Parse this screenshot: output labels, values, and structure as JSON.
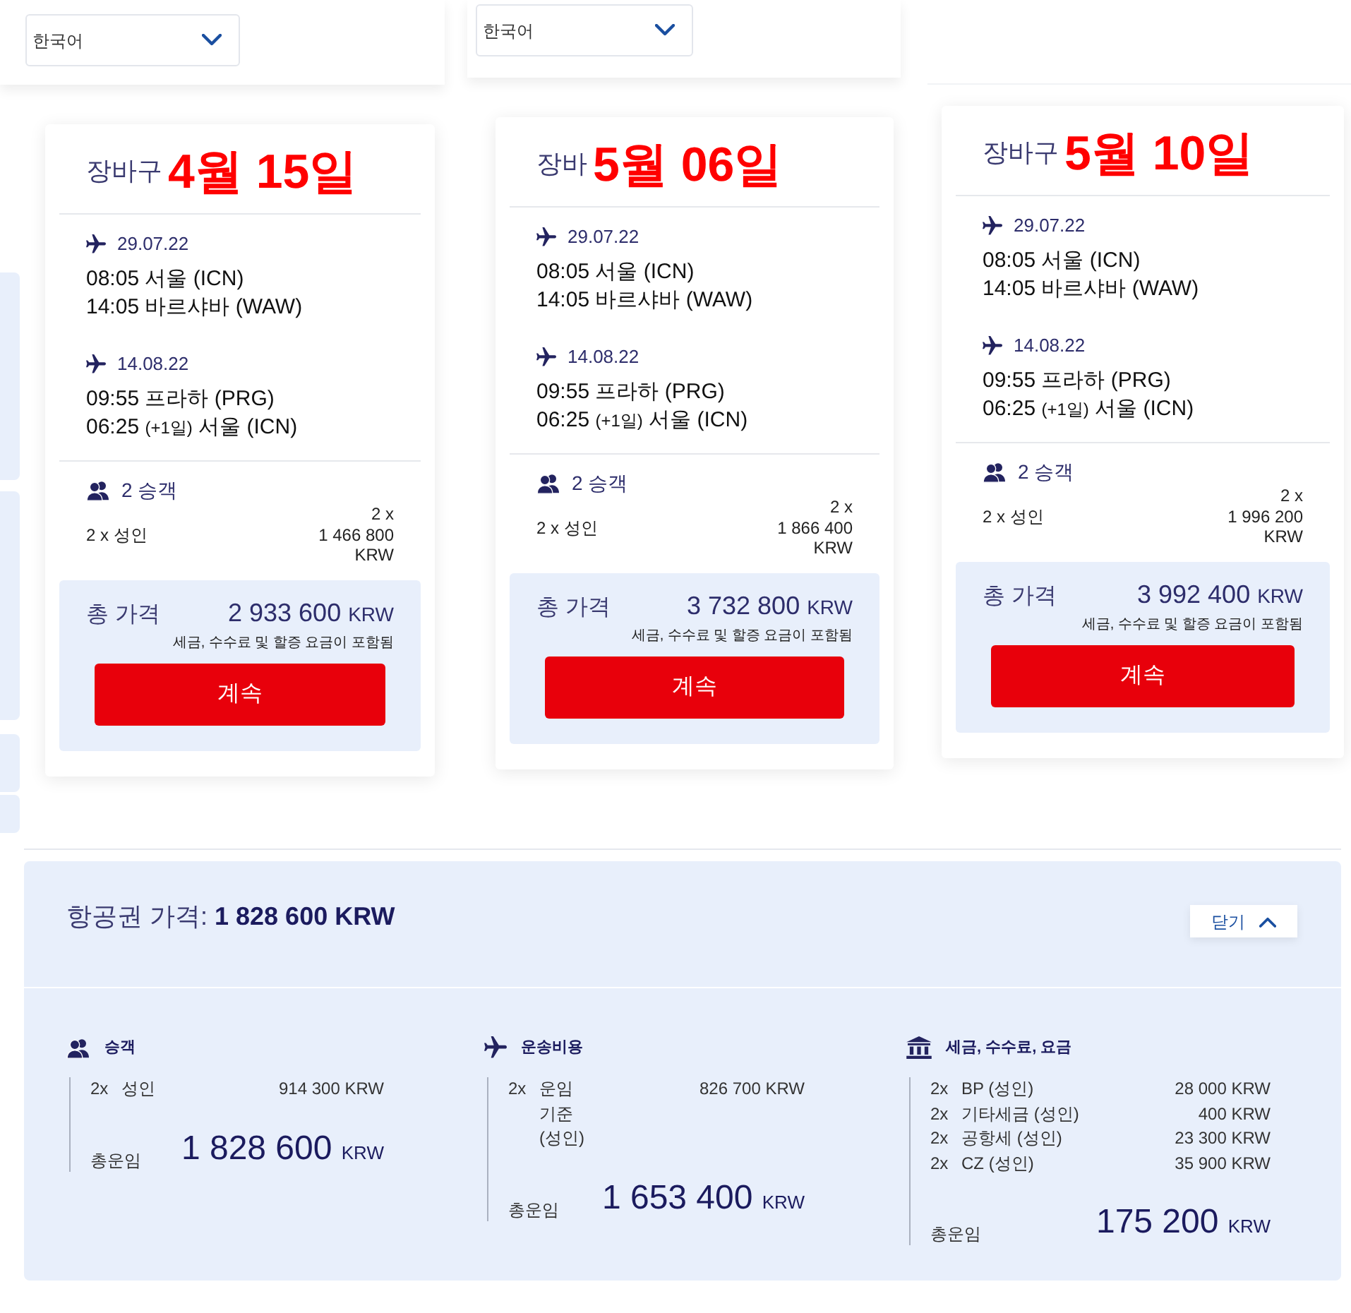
{
  "carts": [
    {
      "language": "한국어",
      "title": "장바구",
      "annotation": "4월 15일",
      "flights": [
        {
          "date": "29.07.22",
          "lines": [
            {
              "time": "08:05",
              "place": "서울 (ICN)"
            },
            {
              "time": "14:05",
              "place": "바르샤바 (WAW)"
            }
          ]
        },
        {
          "date": "14.08.22",
          "lines": [
            {
              "time": "09:55",
              "place": "프라하 (PRG)"
            },
            {
              "time": "06:25",
              "day_offset": "(+1일)",
              "place": "서울 (ICN)"
            }
          ]
        }
      ],
      "passengers": {
        "label": "2 승객",
        "rows": [
          {
            "label": "2 x 성인",
            "price_lines": [
              "2 x",
              "1 466 800",
              "KRW"
            ]
          }
        ]
      },
      "total": {
        "label": "총 가격",
        "amount": "2 933 600",
        "currency": "KRW",
        "note": "세금, 수수료 및 할증 요금이 포함됨"
      },
      "button": "계속"
    },
    {
      "language": "한국어",
      "title": "장바",
      "annotation": "5월 06일",
      "flights": [
        {
          "date": "29.07.22",
          "lines": [
            {
              "time": "08:05",
              "place": "서울 (ICN)"
            },
            {
              "time": "14:05",
              "place": "바르샤바 (WAW)"
            }
          ]
        },
        {
          "date": "14.08.22",
          "lines": [
            {
              "time": "09:55",
              "place": "프라하 (PRG)"
            },
            {
              "time": "06:25",
              "day_offset": "(+1일)",
              "place": "서울 (ICN)"
            }
          ]
        }
      ],
      "passengers": {
        "label": "2 승객",
        "rows": [
          {
            "label": "2 x 성인",
            "price_lines": [
              "2 x",
              "1 866 400",
              "KRW"
            ]
          }
        ]
      },
      "total": {
        "label": "총 가격",
        "amount": "3 732 800",
        "currency": "KRW",
        "note": "세금, 수수료 및 할증 요금이 포함됨"
      },
      "button": "계속"
    },
    {
      "title": "장바구",
      "annotation": "5월 10일",
      "flights": [
        {
          "date": "29.07.22",
          "lines": [
            {
              "time": "08:05",
              "place": "서울 (ICN)"
            },
            {
              "time": "14:05",
              "place": "바르샤바 (WAW)"
            }
          ]
        },
        {
          "date": "14.08.22",
          "lines": [
            {
              "time": "09:55",
              "place": "프라하 (PRG)"
            },
            {
              "time": "06:25",
              "day_offset": "(+1일)",
              "place": "서울 (ICN)"
            }
          ]
        }
      ],
      "passengers": {
        "label": "2 승객",
        "rows": [
          {
            "label": "2 x 성인",
            "price_lines": [
              "2 x",
              "1 996 200",
              "KRW"
            ]
          }
        ]
      },
      "total": {
        "label": "총 가격",
        "amount": "3 992 400",
        "currency": "KRW",
        "note": "세금, 수수료 및 할증 요금이 포함됨"
      },
      "button": "계속"
    }
  ],
  "fare_breakdown": {
    "title": "항공권 가격: **1 828 600 KRW**",
    "close_button": "닫기",
    "sections": [
      {
        "kind": "passengers",
        "title": "승객",
        "rows": [
          {
            "count": "2x",
            "label": "성인",
            "amount": "914 300 KRW"
          }
        ],
        "total_label": "총운임",
        "total_amount": "1 828 600",
        "total_currency": "KRW"
      },
      {
        "kind": "transport",
        "title": "운송비용",
        "rows": [
          {
            "count": "2x",
            "label": "운임 기준 (성인)",
            "amount": "826 700 KRW"
          }
        ],
        "total_label": "총운임",
        "total_amount": "1 653 400",
        "total_currency": "KRW"
      },
      {
        "kind": "taxes",
        "title": "세금, 수수료, 요금",
        "rows": [
          {
            "count": "2x",
            "label": "BP (성인)",
            "amount": "28 000 KRW"
          },
          {
            "count": "2x",
            "label": "기타세금 (성인)",
            "amount": "400 KRW"
          },
          {
            "count": "2x",
            "label": "공항세 (성인)",
            "amount": "23 300 KRW"
          },
          {
            "count": "2x",
            "label": "CZ (성인)",
            "amount": "35 900 KRW"
          }
        ],
        "total_label": "총운임",
        "total_amount": "175 200",
        "total_currency": "KRW"
      }
    ]
  }
}
